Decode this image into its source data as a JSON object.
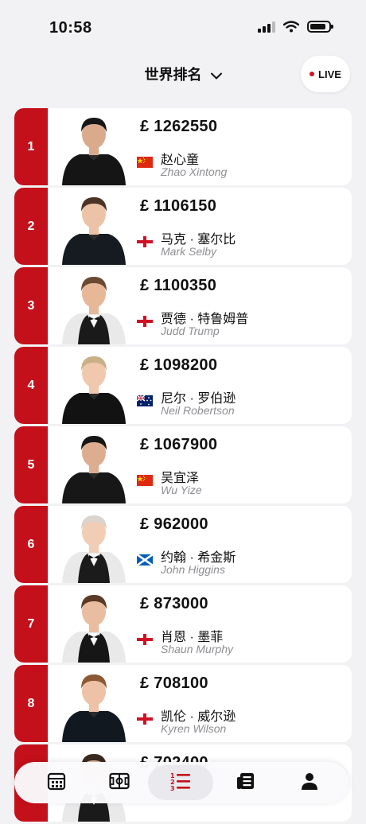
{
  "status_bar": {
    "time": "10:58"
  },
  "header": {
    "title": "世界排名",
    "live_label": "LIVE"
  },
  "rankings": [
    {
      "rank": "1",
      "prize": "£ 1262550",
      "name_cn": "赵心童",
      "name_en": "Zhao Xintong",
      "flag": "china"
    },
    {
      "rank": "2",
      "prize": "£ 1106150",
      "name_cn": "马克 · 塞尔比",
      "name_en": "Mark Selby",
      "flag": "england"
    },
    {
      "rank": "3",
      "prize": "£ 1100350",
      "name_cn": "贾德 · 特鲁姆普",
      "name_en": "Judd Trump",
      "flag": "england"
    },
    {
      "rank": "4",
      "prize": "£ 1098200",
      "name_cn": "尼尔 · 罗伯逊",
      "name_en": "Neil Robertson",
      "flag": "australia"
    },
    {
      "rank": "5",
      "prize": "£ 1067900",
      "name_cn": "吴宜泽",
      "name_en": "Wu Yize",
      "flag": "china"
    },
    {
      "rank": "6",
      "prize": "£ 962000",
      "name_cn": "约翰 · 希金斯",
      "name_en": "John Higgins",
      "flag": "scotland"
    },
    {
      "rank": "7",
      "prize": "£ 873000",
      "name_cn": "肖恩 · 墨菲",
      "name_en": "Shaun Murphy",
      "flag": "england"
    },
    {
      "rank": "8",
      "prize": "£ 708100",
      "name_cn": "凯伦 · 威尔逊",
      "name_en": "Kyren Wilson",
      "flag": "england"
    },
    {
      "rank": "",
      "prize": "£ 702400",
      "name_cn": "",
      "name_en": "",
      "flag": ""
    }
  ],
  "tab_bar": {
    "tabs": [
      "calendar-icon",
      "scores-icon",
      "rankings-icon",
      "news-icon",
      "profile-icon"
    ],
    "active": "rankings-icon"
  },
  "colors": {
    "accent": "#c4101b",
    "live_dot": "#d4111e",
    "background": "#f2f2f4"
  }
}
